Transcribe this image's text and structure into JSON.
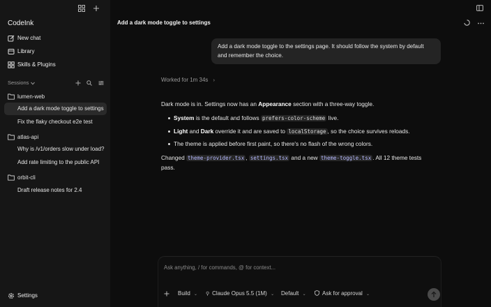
{
  "app": {
    "name": "CodeInk"
  },
  "sidebar": {
    "nav": [
      {
        "label": "New chat",
        "icon": "edit-icon"
      },
      {
        "label": "Library",
        "icon": "library-icon"
      },
      {
        "label": "Skills & Plugins",
        "icon": "grid-icon"
      }
    ],
    "sessions_label": "Sessions",
    "projects": [
      {
        "name": "lumen-web",
        "sessions": [
          "Add a dark mode toggle to settings",
          "Fix the flaky checkout e2e test"
        ]
      },
      {
        "name": "atlas-api",
        "sessions": [
          "Why is /v1/orders slow under load?",
          "Add rate limiting to the public API"
        ]
      },
      {
        "name": "orbit-cli",
        "sessions": [
          "Draft release notes for 2.4"
        ]
      }
    ],
    "settings_label": "Settings"
  },
  "header": {
    "title": "Add a dark mode toggle to settings"
  },
  "conversation": {
    "user_message_line1": "Add a dark mode toggle to the settings page. It should follow the system by default",
    "user_message_line2": "and remember the choice.",
    "worked_for": "Worked for 1m 34s",
    "intro_a": "Dark mode is in. Settings now has an ",
    "intro_b": "Appearance",
    "intro_c": " section with a three-way toggle.",
    "bullets": [
      {
        "bold": "System",
        "text_a": " is the default and follows ",
        "code": "prefers-color-scheme",
        "text_b": " live."
      },
      {
        "bold": "Light",
        "mid": " and ",
        "bold2": "Dark",
        "text_a": " override it and are saved to ",
        "code": "localStorage",
        "text_b": ", so the choice survives reloads."
      },
      {
        "text": "The theme is applied before first paint, so there's no flash of the wrong colors."
      }
    ],
    "changed_prefix": "Changed ",
    "files": [
      "theme-provider.tsx",
      "settings.tsx",
      "theme-toggle.tsx"
    ],
    "sep1": ", ",
    "sep2": " and a new ",
    "changed_suffix": ". All 12 theme tests",
    "changed_line2": "pass."
  },
  "composer": {
    "placeholder": "Ask anything, / for commands, @ for context...",
    "mode": "Build",
    "model": "Claude Opus 5.5 (1M)",
    "preset": "Default",
    "approval": "Ask for approval"
  },
  "colors": {
    "sidebar_bg": "#161616",
    "main_bg": "#0d0d0d",
    "accent_code": "#b5b9ff",
    "user_bubble": "#242424"
  }
}
